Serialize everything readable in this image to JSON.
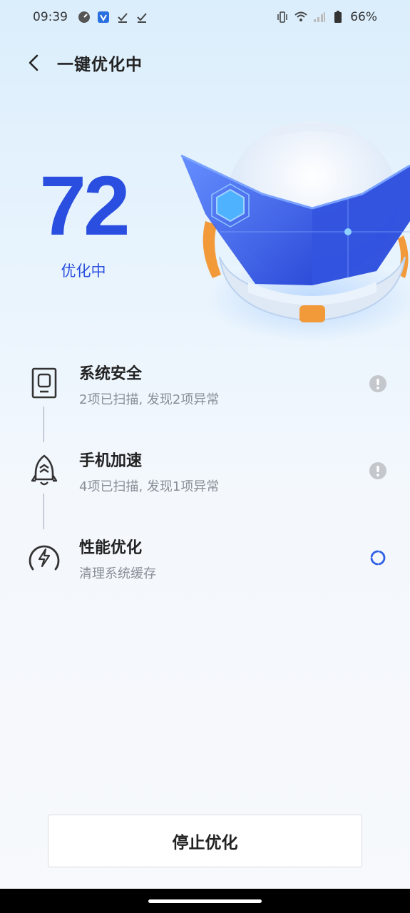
{
  "status_bar": {
    "time": "09:39",
    "battery": "66%",
    "left_icons": [
      "app-icon",
      "shield-app-icon",
      "check-notification-icon",
      "check-notification-icon"
    ],
    "right_icons": [
      "vibrate-icon",
      "wifi-icon",
      "signal-icon",
      "battery-icon"
    ]
  },
  "header": {
    "title": "一键优化中"
  },
  "score": {
    "value": "72",
    "label": "优化中"
  },
  "items": [
    {
      "title": "系统安全",
      "subtitle": "2项已扫描, 发现2项异常",
      "icon": "security-icon",
      "status": "warning-icon"
    },
    {
      "title": "手机加速",
      "subtitle": "4项已扫描, 发现1项异常",
      "icon": "rocket-icon",
      "status": "warning-icon"
    },
    {
      "title": "性能优化",
      "subtitle": "清理系统缓存",
      "icon": "speedometer-icon",
      "status": "loading-icon"
    }
  ],
  "stop_button": {
    "label": "停止优化"
  },
  "colors": {
    "accent": "#2a4fe0",
    "warning": "#c4c8cc",
    "loading": "#2f5fe5"
  }
}
